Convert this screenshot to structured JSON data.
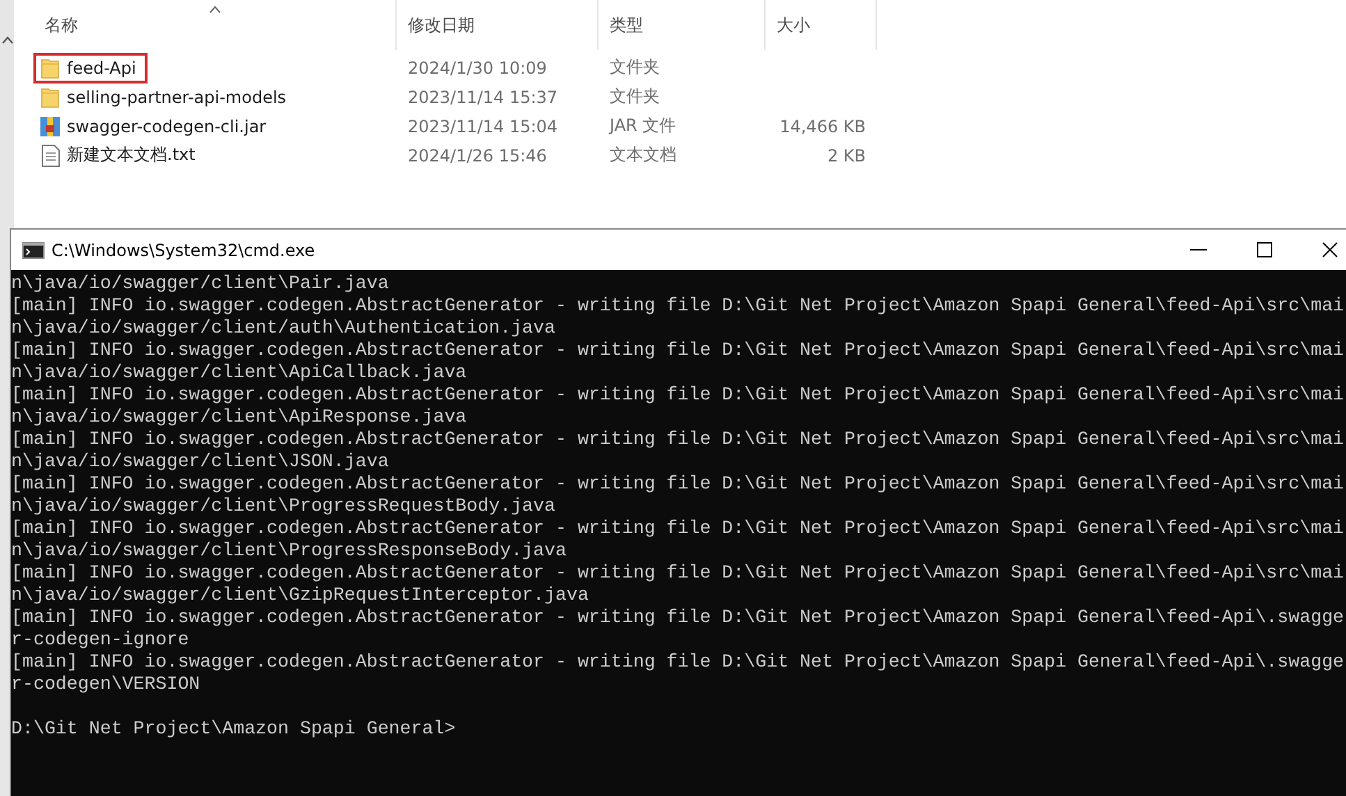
{
  "explorer": {
    "columns": [
      {
        "label": "名称",
        "sorted": true
      },
      {
        "label": "修改日期",
        "sorted": false
      },
      {
        "label": "类型",
        "sorted": false
      },
      {
        "label": "大小",
        "sorted": false
      }
    ],
    "files": [
      {
        "kind": "folder",
        "name": "feed-Api",
        "modified": "2024/1/30 10:09",
        "type": "文件夹",
        "highlighted": true
      },
      {
        "kind": "folder",
        "name": "selling-partner-api-models",
        "modified": "2023/11/14 15:37",
        "type": "文件夹",
        "highlighted": false
      },
      {
        "kind": "jar",
        "name": "swagger-codegen-cli.jar",
        "modified": "2023/11/14 15:04",
        "type": "JAR 文件",
        "size": "14,466 KB",
        "highlighted": false
      },
      {
        "kind": "text",
        "name": "新建文本文档.txt",
        "modified": "2024/1/26 15:46",
        "type": "文本文档",
        "size": "2 KB",
        "highlighted": false
      }
    ]
  },
  "console": {
    "title": "C:\\Windows\\System32\\cmd.exe",
    "lines": [
      "n\\java/io/swagger/client\\Pair.java",
      "[main] INFO io.swagger.codegen.AbstractGenerator - writing file D:\\Git Net Project\\Amazon Spapi General\\feed-Api\\src\\mai",
      "n\\java/io/swagger/client/auth\\Authentication.java",
      "[main] INFO io.swagger.codegen.AbstractGenerator - writing file D:\\Git Net Project\\Amazon Spapi General\\feed-Api\\src\\mai",
      "n\\java/io/swagger/client\\ApiCallback.java",
      "[main] INFO io.swagger.codegen.AbstractGenerator - writing file D:\\Git Net Project\\Amazon Spapi General\\feed-Api\\src\\mai",
      "n\\java/io/swagger/client\\ApiResponse.java",
      "[main] INFO io.swagger.codegen.AbstractGenerator - writing file D:\\Git Net Project\\Amazon Spapi General\\feed-Api\\src\\mai",
      "n\\java/io/swagger/client\\JSON.java",
      "[main] INFO io.swagger.codegen.AbstractGenerator - writing file D:\\Git Net Project\\Amazon Spapi General\\feed-Api\\src\\mai",
      "n\\java/io/swagger/client\\ProgressRequestBody.java",
      "[main] INFO io.swagger.codegen.AbstractGenerator - writing file D:\\Git Net Project\\Amazon Spapi General\\feed-Api\\src\\mai",
      "n\\java/io/swagger/client\\ProgressResponseBody.java",
      "[main] INFO io.swagger.codegen.AbstractGenerator - writing file D:\\Git Net Project\\Amazon Spapi General\\feed-Api\\src\\mai",
      "n\\java/io/swagger/client\\GzipRequestInterceptor.java",
      "[main] INFO io.swagger.codegen.AbstractGenerator - writing file D:\\Git Net Project\\Amazon Spapi General\\feed-Api\\.swagge",
      "r-codegen-ignore",
      "[main] INFO io.swagger.codegen.AbstractGenerator - writing file D:\\Git Net Project\\Amazon Spapi General\\feed-Api\\.swagge",
      "r-codegen\\VERSION"
    ],
    "prompt": "D:\\Git Net Project\\Amazon Spapi General>"
  }
}
